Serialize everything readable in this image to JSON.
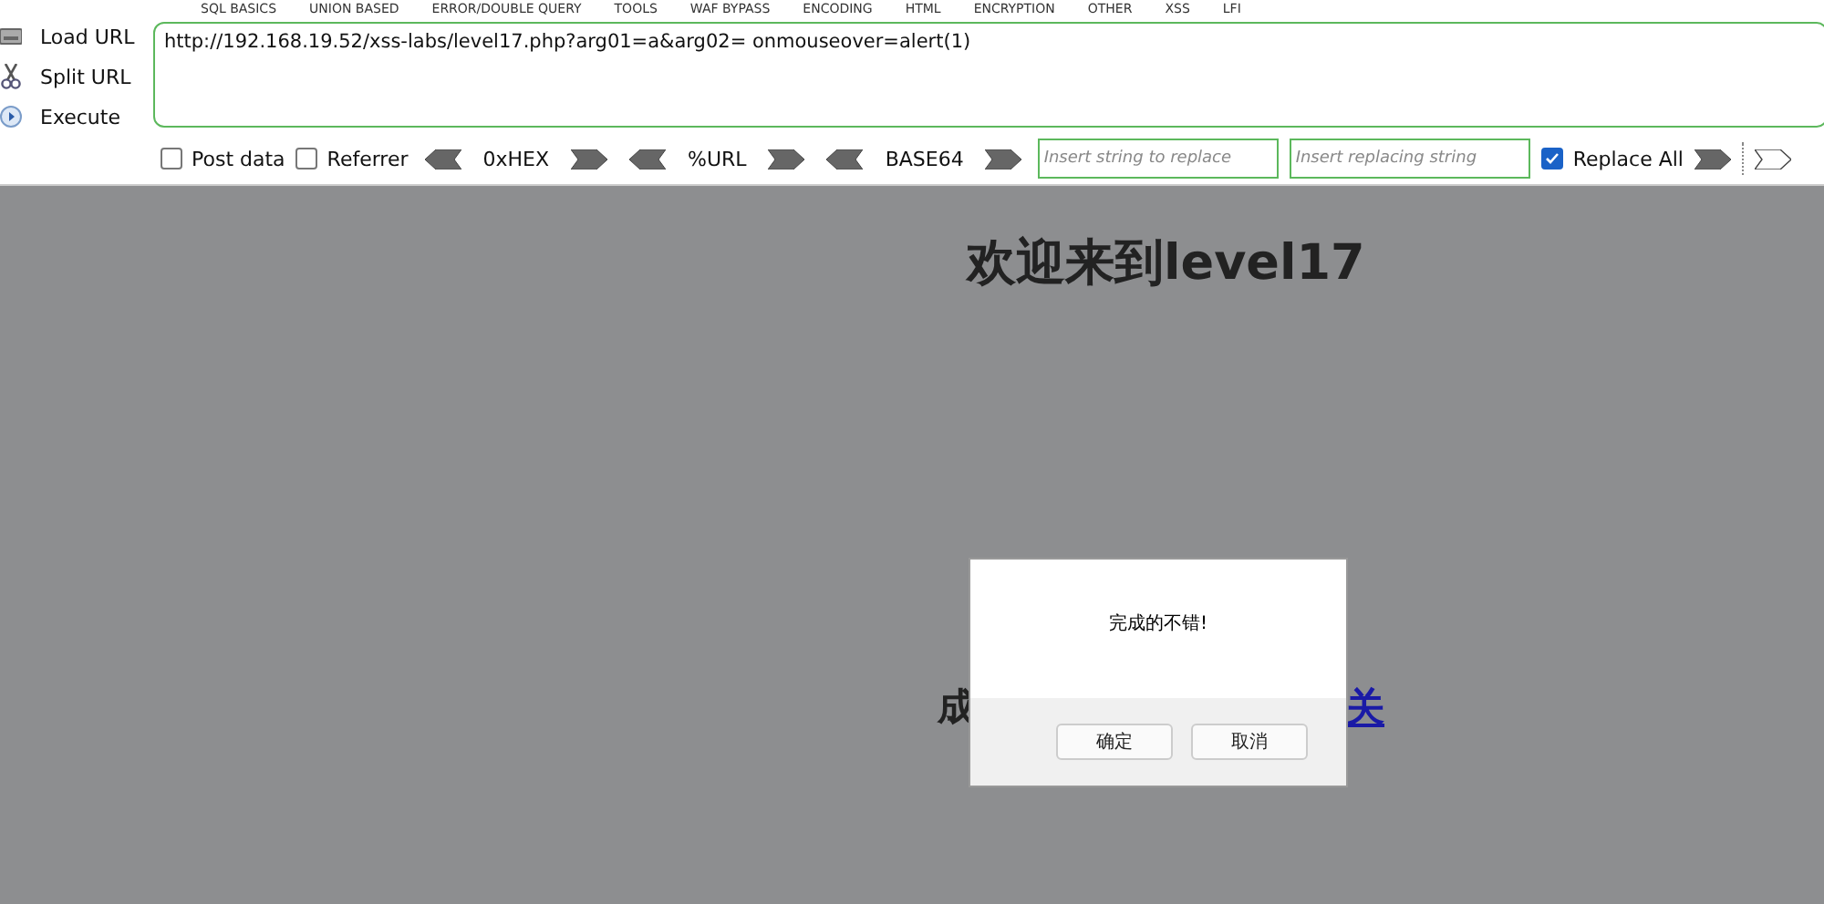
{
  "menu": [
    "SQL BASICS",
    "UNION BASED",
    "ERROR/DOUBLE QUERY",
    "TOOLS",
    "WAF BYPASS",
    "ENCODING",
    "HTML",
    "ENCRYPTION",
    "OTHER",
    "XSS",
    "LFI"
  ],
  "actions": [
    {
      "label": "Load URL",
      "kind": "load"
    },
    {
      "label": "Split URL",
      "kind": "split"
    },
    {
      "label": "Execute",
      "kind": "execute"
    }
  ],
  "url": "http://192.168.19.52/xss-labs/level17.php?arg01=a&arg02= onmouseover=alert(1)",
  "post_data": {
    "label": "Post data",
    "checked": false
  },
  "referrer": {
    "label": "Referrer",
    "checked": false
  },
  "encoders": [
    "0xHEX",
    "%URL",
    "BASE64"
  ],
  "replace_from": {
    "placeholder": "Insert string to replace"
  },
  "replace_to": {
    "placeholder": "Insert replacing string"
  },
  "replace_all": {
    "label": "Replace All",
    "checked": true
  },
  "page": {
    "heading": "欢迎来到level17",
    "text_fragment": "成",
    "link_fragment": "关"
  },
  "dialog": {
    "message": "完成的不错!",
    "buttons": [
      "确定",
      "取消"
    ]
  }
}
